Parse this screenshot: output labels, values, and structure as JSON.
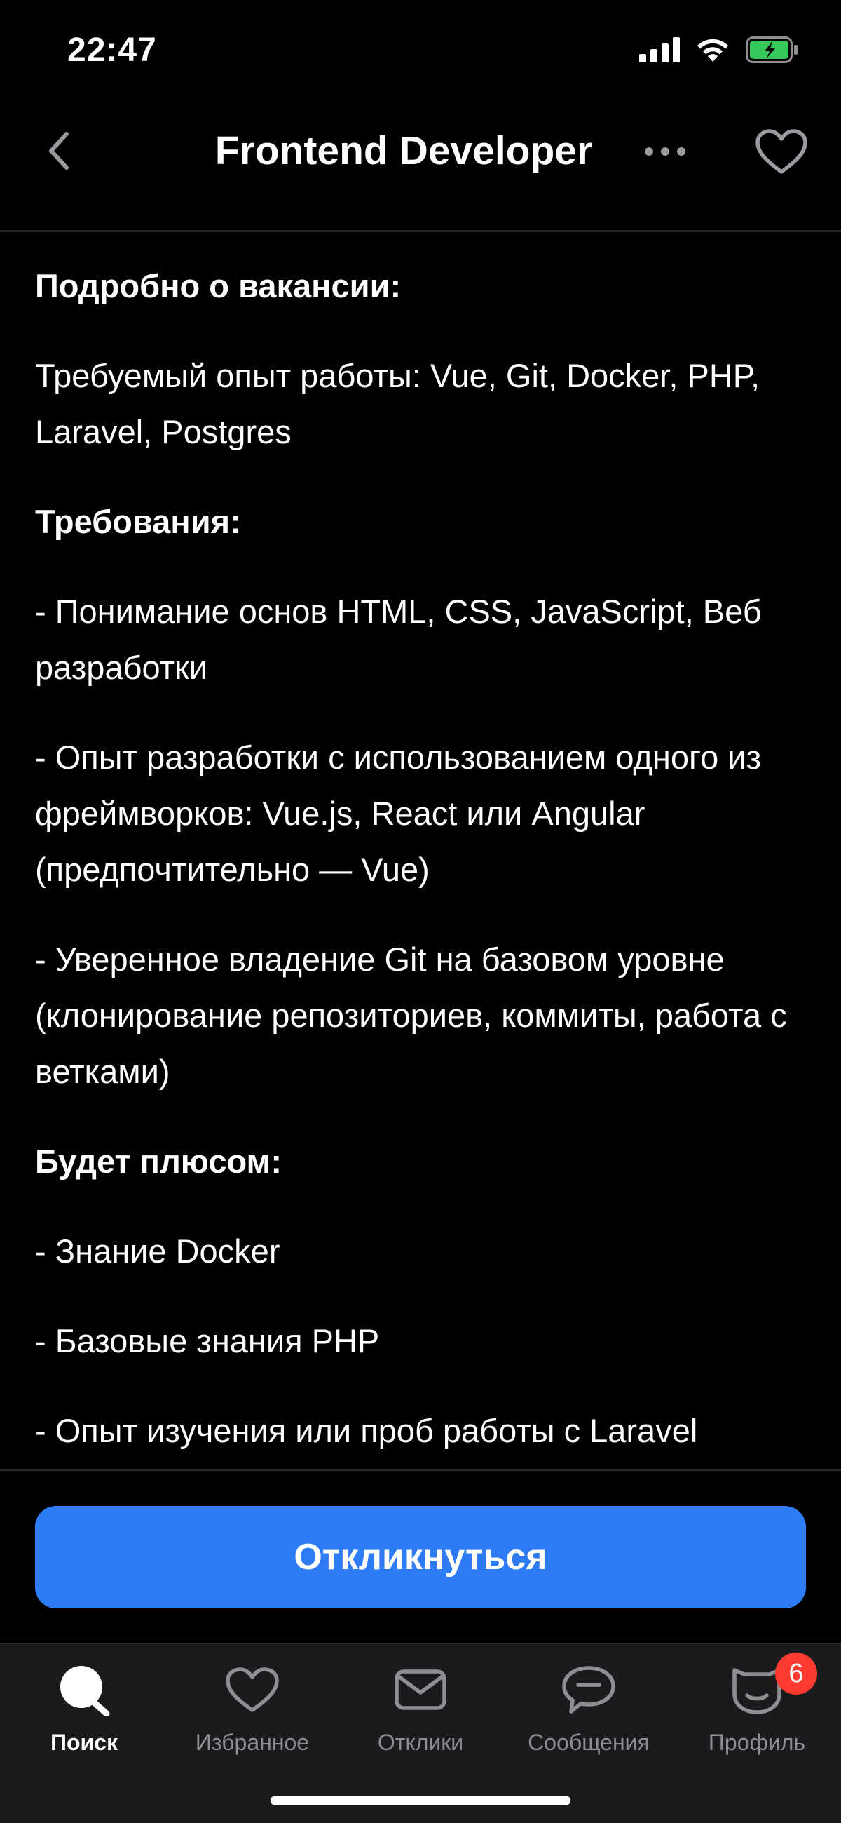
{
  "status_bar": {
    "time": "22:47"
  },
  "header": {
    "title": "Frontend Developer",
    "icons": {
      "back": "chevron-left-icon",
      "more": "more-horizontal-icon",
      "favorite": "heart-outline-icon"
    }
  },
  "content": {
    "paragraphs": [
      {
        "type": "heading",
        "text": "Подробно о вакансии:"
      },
      {
        "type": "text",
        "text": "Требуемый опыт работы: Vue, Git, Docker, PHP, Laravel, Postgres"
      },
      {
        "type": "heading",
        "text": "Требования:"
      },
      {
        "type": "text",
        "text": "- Понимание основ HTML, CSS, JavaScript, Веб разработки"
      },
      {
        "type": "text",
        "text": "- Опыт разработки с использованием одного из фреймворков: Vue.js, React или Angular (предпочтительно — Vue)"
      },
      {
        "type": "text",
        "text": "- Уверенное владение Git на базовом уровне (клонирование репозиториев, коммиты, работа с ветками)"
      },
      {
        "type": "heading",
        "text": "Будет плюсом:"
      },
      {
        "type": "text",
        "text": "- Знание Docker"
      },
      {
        "type": "text",
        "text": "- Базовые знания PHP"
      },
      {
        "type": "text",
        "text": "- Опыт изучения или проб работы с Laravel"
      }
    ]
  },
  "cta": {
    "apply_label": "Откликнуться",
    "color": "#2e7bf6"
  },
  "tab_bar": {
    "tabs": [
      {
        "label": "Поиск",
        "icon": "search-icon",
        "active": true
      },
      {
        "label": "Избранное",
        "icon": "heart-icon",
        "active": false
      },
      {
        "label": "Отклики",
        "icon": "envelope-icon",
        "active": false
      },
      {
        "label": "Сообщения",
        "icon": "chat-bubble-icon",
        "active": false
      },
      {
        "label": "Профиль",
        "icon": "profile-icon",
        "active": false,
        "badge": "6"
      }
    ]
  }
}
